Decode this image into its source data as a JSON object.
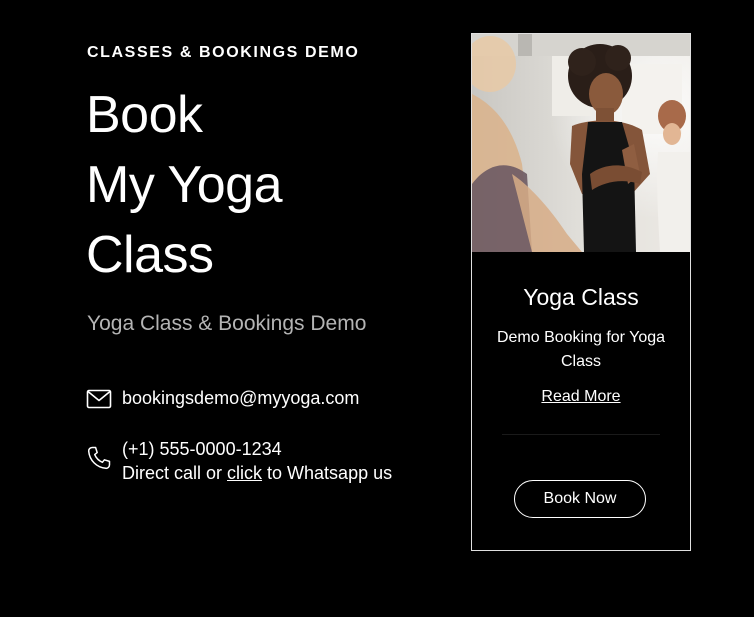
{
  "hero": {
    "eyebrow": "CLASSES & BOOKINGS DEMO",
    "title_lines": [
      "Book",
      "My Yoga",
      "Class"
    ],
    "subtitle": "Yoga Class & Bookings Demo"
  },
  "contact": {
    "email": "bookingsdemo@myyoga.com",
    "phone": "(+1) 555-0000-1234",
    "call_prefix": "Direct call or ",
    "call_link": "click",
    "call_suffix": " to Whatsapp us",
    "email_icon": "envelope-icon",
    "phone_icon": "phone-icon"
  },
  "card": {
    "title": "Yoga Class",
    "description": "Demo Booking for Yoga Class",
    "read_more": "Read More",
    "book_now": "Book Now"
  },
  "colors": {
    "background": "#000000",
    "text": "#ffffff",
    "subtitle": "#b4b4b4"
  }
}
